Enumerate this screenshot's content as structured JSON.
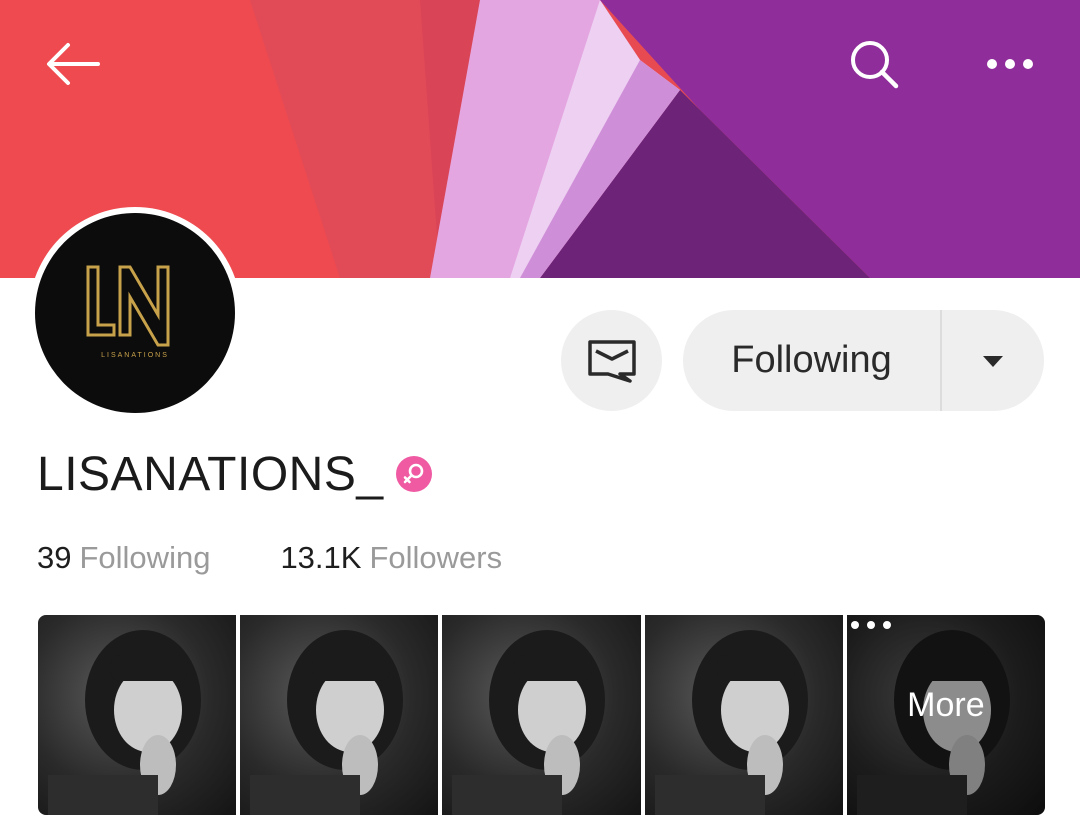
{
  "header": {
    "back_icon": "arrow-left-icon",
    "search_icon": "search-icon",
    "more_icon": "more-horizontal-icon",
    "cover_colors": [
      "#e8464f",
      "#d93b4a",
      "#e99ad6",
      "#f0c8f0",
      "#8a2c95",
      "#6a2276"
    ]
  },
  "avatar": {
    "logo_text": "LISANATIONS",
    "logo_color": "#c8a24a"
  },
  "actions": {
    "message_icon": "message-icon",
    "following_label": "Following",
    "dropdown_icon": "caret-down-icon"
  },
  "profile": {
    "username": "LISANATIONS_",
    "gender_icon": "female-icon",
    "gender_color": "#ef5aa2"
  },
  "stats": {
    "following_count": "39",
    "following_label": "Following",
    "followers_count": "13.1K",
    "followers_label": "Followers"
  },
  "photos": {
    "count": 5,
    "more_label": "More",
    "more_icon": "more-horizontal-icon"
  }
}
